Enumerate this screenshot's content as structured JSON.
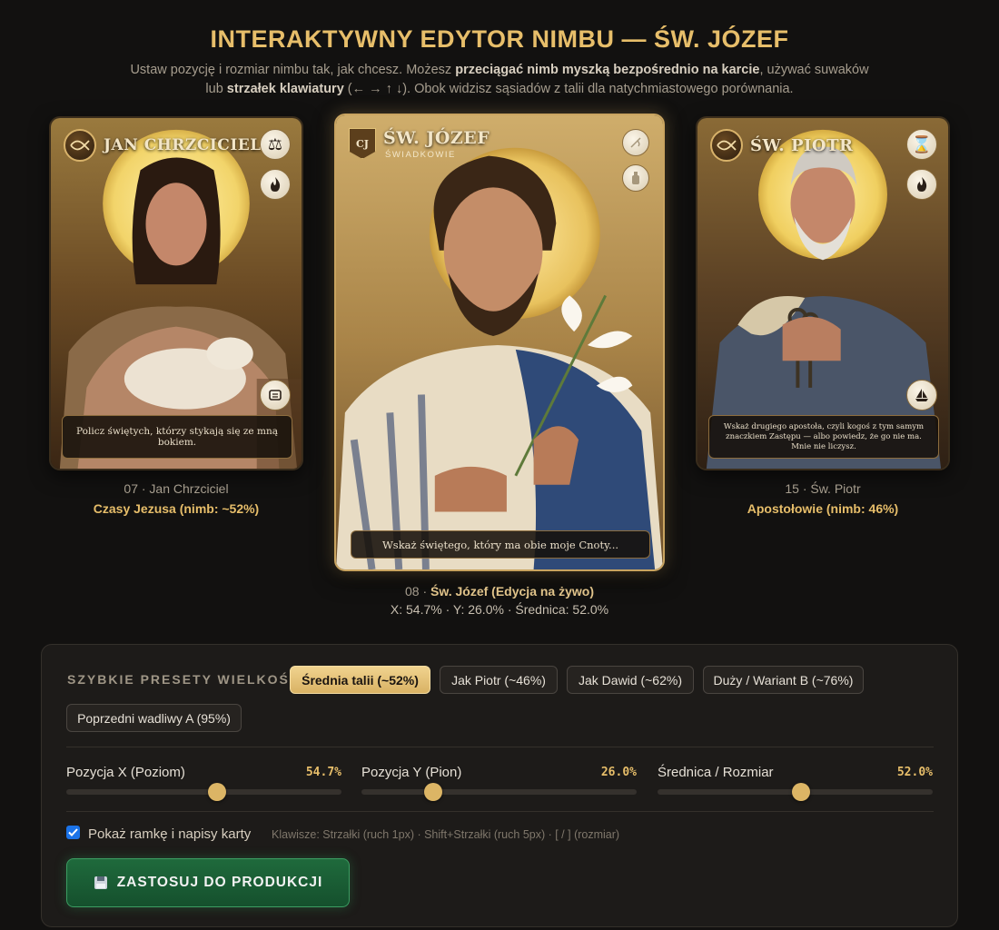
{
  "header": {
    "title": "INTERAKTYWNY EDYTOR NIMBU — ŚW. JÓZEF",
    "subtitle_1": "Ustaw pozycję i rozmiar nimbu tak, jak chcesz. Możesz ",
    "subtitle_bold_1": "przeciągać nimb myszką bezpośrednio na karcie",
    "subtitle_2": ", używać suwaków lub ",
    "subtitle_bold_2": "strzałek klawiatury",
    "subtitle_3": " (← → ↑ ↓). Obok widzisz sąsiadów z talii dla natychmiastowego porównania."
  },
  "cards": {
    "left": {
      "name": "JAN CHRZCICIEL",
      "text": "Policz świętych, którzy stykają się ze mną bokiem.",
      "caption_num": "07 · Jan Chrzciciel",
      "caption_info": "Czasy Jezusa (nimb: ~52%)"
    },
    "center": {
      "name": "ŚW. JÓZEF",
      "group": "ŚWIADKOWIE",
      "emblem": "CJ",
      "text": "Wskaż świętego, który ma obie moje Cnoty...",
      "caption_num": "08 · ",
      "caption_title": "Św. Józef (Edycja na żywo)",
      "caption_info": "X: 54.7% · Y: 26.0% · Średnica: 52.0%"
    },
    "right": {
      "name": "ŚW. PIOTR",
      "text": "Wskaż drugiego apostoła, czyli kogoś z tym samym znaczkiem Zastępu — albo powiedz, że go nie ma. Mnie nie liczysz.",
      "caption_num": "15 · Św. Piotr",
      "caption_info": "Apostołowie (nimb: 46%)"
    }
  },
  "presets": {
    "label": "SZYBKIE PRESETY WIELKOŚCI:",
    "items": [
      "Średnia talii (~52%)",
      "Jak Piotr (~46%)",
      "Jak Dawid (~62%)",
      "Duży / Wariant B (~76%)",
      "Poprzedni wadliwy A (95%)"
    ]
  },
  "sliders": {
    "x": {
      "label": "Pozycja X (Poziom)",
      "display": "54.7%",
      "value": 54.7
    },
    "y": {
      "label": "Pozycja Y (Pion)",
      "display": "26.0%",
      "value": 26.0
    },
    "size": {
      "label": "Średnica / Rozmiar",
      "display": "52.0%",
      "value": 52.0
    }
  },
  "options": {
    "show_frame_label": "Pokaż ramkę i napisy karty",
    "show_frame_checked": true,
    "keys_hint": "Klawisze: Strzałki (ruch 1px) · Shift+Strzałki (ruch 5px) · [ / ] (rozmiar)"
  },
  "apply_button": {
    "label": "ZASTOSUJ DO PRODUKCJI",
    "icon": "floppy-disk-icon"
  },
  "colors": {
    "accent": "#e7be6a",
    "apply": "#1f6a3c",
    "checkbox": "#1b73e8"
  }
}
